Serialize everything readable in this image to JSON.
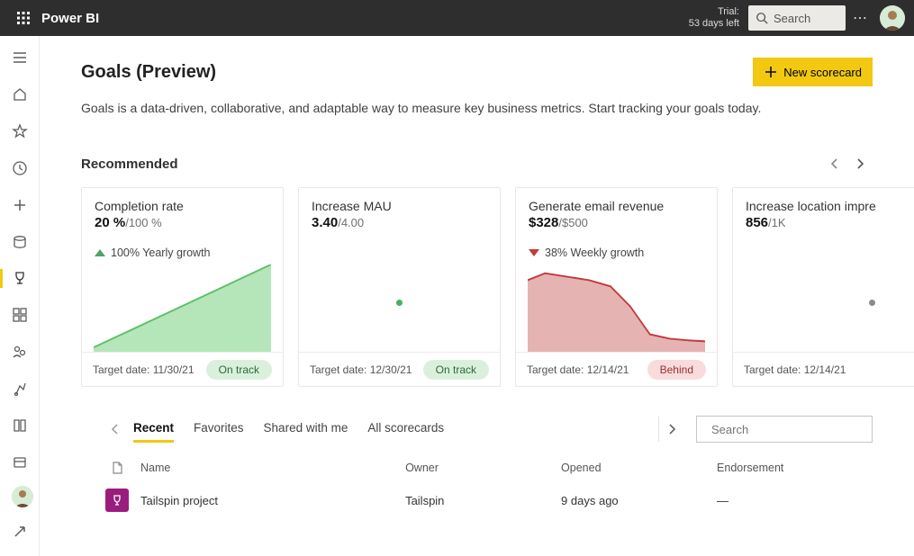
{
  "header": {
    "brand": "Power BI",
    "trial_label": "Trial:",
    "trial_remaining": "53 days left",
    "search_placeholder": "Search"
  },
  "page": {
    "title": "Goals (Preview)",
    "subtitle": "Goals is a data-driven, collaborative, and adaptable way to measure key business metrics. Start tracking your goals today.",
    "new_button": "New scorecard"
  },
  "recommended": {
    "section_title": "Recommended",
    "cards": [
      {
        "title": "Completion rate",
        "current": "20 %",
        "target": "/100 %",
        "growth": "100% Yearly growth",
        "trend": "up",
        "footer_date": "Target date: 11/30/21",
        "status": "On track",
        "status_type": "ontrack"
      },
      {
        "title": "Increase MAU",
        "current": "3.40",
        "target": "/4.00",
        "growth": "",
        "trend": "dot-green",
        "footer_date": "Target date: 12/30/21",
        "status": "On track",
        "status_type": "ontrack"
      },
      {
        "title": "Generate email revenue",
        "current": "$328",
        "target": "/$500",
        "growth": "38% Weekly growth",
        "trend": "down",
        "footer_date": "Target date: 12/14/21",
        "status": "Behind",
        "status_type": "behind"
      },
      {
        "title": "Increase location impre",
        "current": "856",
        "target": "/1K",
        "growth": "",
        "trend": "dot-grey",
        "footer_date": "Target date: 12/14/21",
        "status": "",
        "status_type": ""
      }
    ]
  },
  "chart_data": [
    {
      "type": "area",
      "title": "Completion rate",
      "values": [
        0,
        25,
        50,
        75,
        100
      ],
      "ylim": [
        0,
        100
      ],
      "color": "#8fd89a"
    },
    {
      "type": "scatter",
      "title": "Increase MAU",
      "values": [
        3.4
      ],
      "color": "#46b05e"
    },
    {
      "type": "area",
      "title": "Generate email revenue",
      "values": [
        88,
        92,
        90,
        86,
        80,
        58,
        22,
        18,
        16,
        15
      ],
      "ylim": [
        0,
        100
      ],
      "color": "#d68b8b"
    },
    {
      "type": "scatter",
      "title": "Increase location impressions",
      "values": [
        856
      ],
      "color": "#8a8a8a"
    }
  ],
  "tabs": {
    "items": [
      "Recent",
      "Favorites",
      "Shared with me",
      "All scorecards"
    ],
    "active_index": 0,
    "search_placeholder": "Search"
  },
  "table": {
    "headers": {
      "name": "Name",
      "owner": "Owner",
      "opened": "Opened",
      "endorsement": "Endorsement"
    },
    "rows": [
      {
        "name": "Tailspin project",
        "owner": "Tailspin",
        "opened": "9 days ago",
        "endorsement": "—"
      }
    ]
  }
}
